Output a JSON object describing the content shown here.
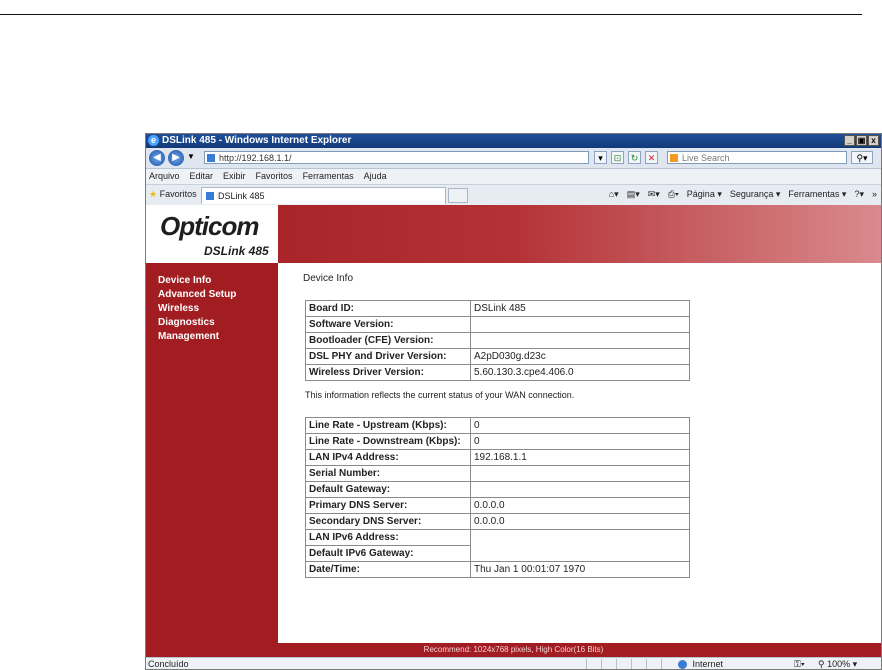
{
  "window": {
    "title": "DSLink 485 - Windows Internet Explorer",
    "controls": [
      "_",
      "▣",
      "x"
    ]
  },
  "address_bar": {
    "url": "http://192.168.1.1/",
    "search_placeholder": "Live Search"
  },
  "menu": [
    "Arquivo",
    "Editar",
    "Exibir",
    "Favoritos",
    "Ferramentas",
    "Ajuda"
  ],
  "favorites_bar": {
    "favorites_label": "Favoritos",
    "tab_label": "DSLink 485",
    "commands": [
      "Página ▾",
      "Segurança ▾",
      "Ferramentas ▾"
    ]
  },
  "logo": {
    "brand": "Opticom",
    "model": "DSLink 485"
  },
  "sidebar": {
    "items": [
      {
        "label": "Device Info"
      },
      {
        "label": "Advanced Setup"
      },
      {
        "label": "Wireless"
      },
      {
        "label": "Diagnostics"
      },
      {
        "label": "Management"
      }
    ]
  },
  "content": {
    "title": "Device Info",
    "table1": [
      {
        "k": "Board ID:",
        "v": "DSLink 485"
      },
      {
        "k": "Software Version:",
        "v": ""
      },
      {
        "k": "Bootloader (CFE) Version:",
        "v": ""
      },
      {
        "k": "DSL PHY and Driver Version:",
        "v": "A2pD030g.d23c"
      },
      {
        "k": "Wireless Driver Version:",
        "v": "5.60.130.3.cpe4.406.0"
      }
    ],
    "note": "This information reflects the current status of your WAN connection.",
    "table2": [
      {
        "k": "Line Rate - Upstream (Kbps):",
        "v": "0"
      },
      {
        "k": "Line Rate - Downstream (Kbps):",
        "v": "0"
      },
      {
        "k": "LAN IPv4 Address:",
        "v": "192.168.1.1"
      },
      {
        "k": "Serial Number:",
        "v": ""
      },
      {
        "k": "Default Gateway:",
        "v": ""
      },
      {
        "k": "Primary DNS Server:",
        "v": "0.0.0.0"
      },
      {
        "k": "Secondary DNS Server:",
        "v": "0.0.0.0"
      },
      {
        "k": "LAN IPv6 Address:",
        "v": ""
      },
      {
        "k": "Default IPv6 Gateway:",
        "v": ""
      },
      {
        "k": "Date/Time:",
        "v": "Thu Jan 1 00:01:07 1970"
      }
    ]
  },
  "footer": {
    "text": "Recommend: 1024x768 pixels, High Color(16 Bits)"
  },
  "status_bar": {
    "left": "Concluído",
    "zone": "Internet",
    "zoom": "100%"
  }
}
